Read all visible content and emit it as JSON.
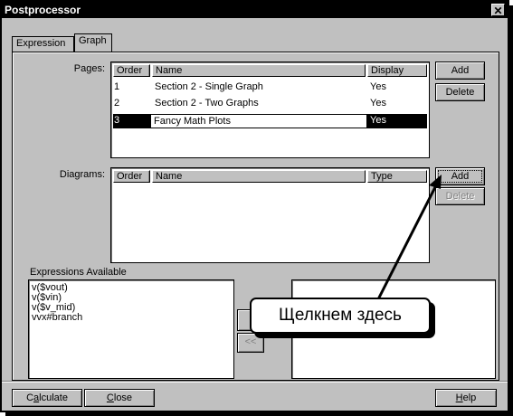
{
  "window": {
    "title": "Postprocessor",
    "close_glyph": "✕"
  },
  "tabs": [
    {
      "label": "Expression",
      "active": false
    },
    {
      "label": "Graph",
      "active": true
    }
  ],
  "pages": {
    "label": "Pages:",
    "columns": [
      "Order",
      "Name",
      "Display"
    ],
    "rows": [
      {
        "order": "1",
        "name": "Section 2 - Single Graph",
        "display": "Yes"
      },
      {
        "order": "2",
        "name": "Section 2 - Two Graphs",
        "display": "Yes"
      },
      {
        "order": "3",
        "name": "Fancy Math Plots",
        "display": "Yes",
        "selected": true
      }
    ],
    "add_label": "Add",
    "delete_label": "Delete"
  },
  "diagrams": {
    "label": "Diagrams:",
    "columns": [
      "Order",
      "Name",
      "Type"
    ],
    "add_label": "Add",
    "delete_label": "Delete"
  },
  "expressions": {
    "label": "Expressions Available",
    "items": [
      "v($vout)",
      "v($vin)",
      "v($v_mid)",
      "vvx#branch"
    ]
  },
  "transfer": {
    "remove_label": "<<"
  },
  "callout": {
    "text": "Щелкнем здесь"
  },
  "footer": {
    "calculate": {
      "pre": "C",
      "acc": "a",
      "post": "lculate"
    },
    "close": {
      "pre": "",
      "acc": "C",
      "post": "lose"
    },
    "help": {
      "pre": "",
      "acc": "H",
      "post": "elp"
    }
  },
  "colors": {
    "dialog_bg": "#c0c0c0",
    "title_bg": "#000000",
    "selection": "#000000"
  }
}
